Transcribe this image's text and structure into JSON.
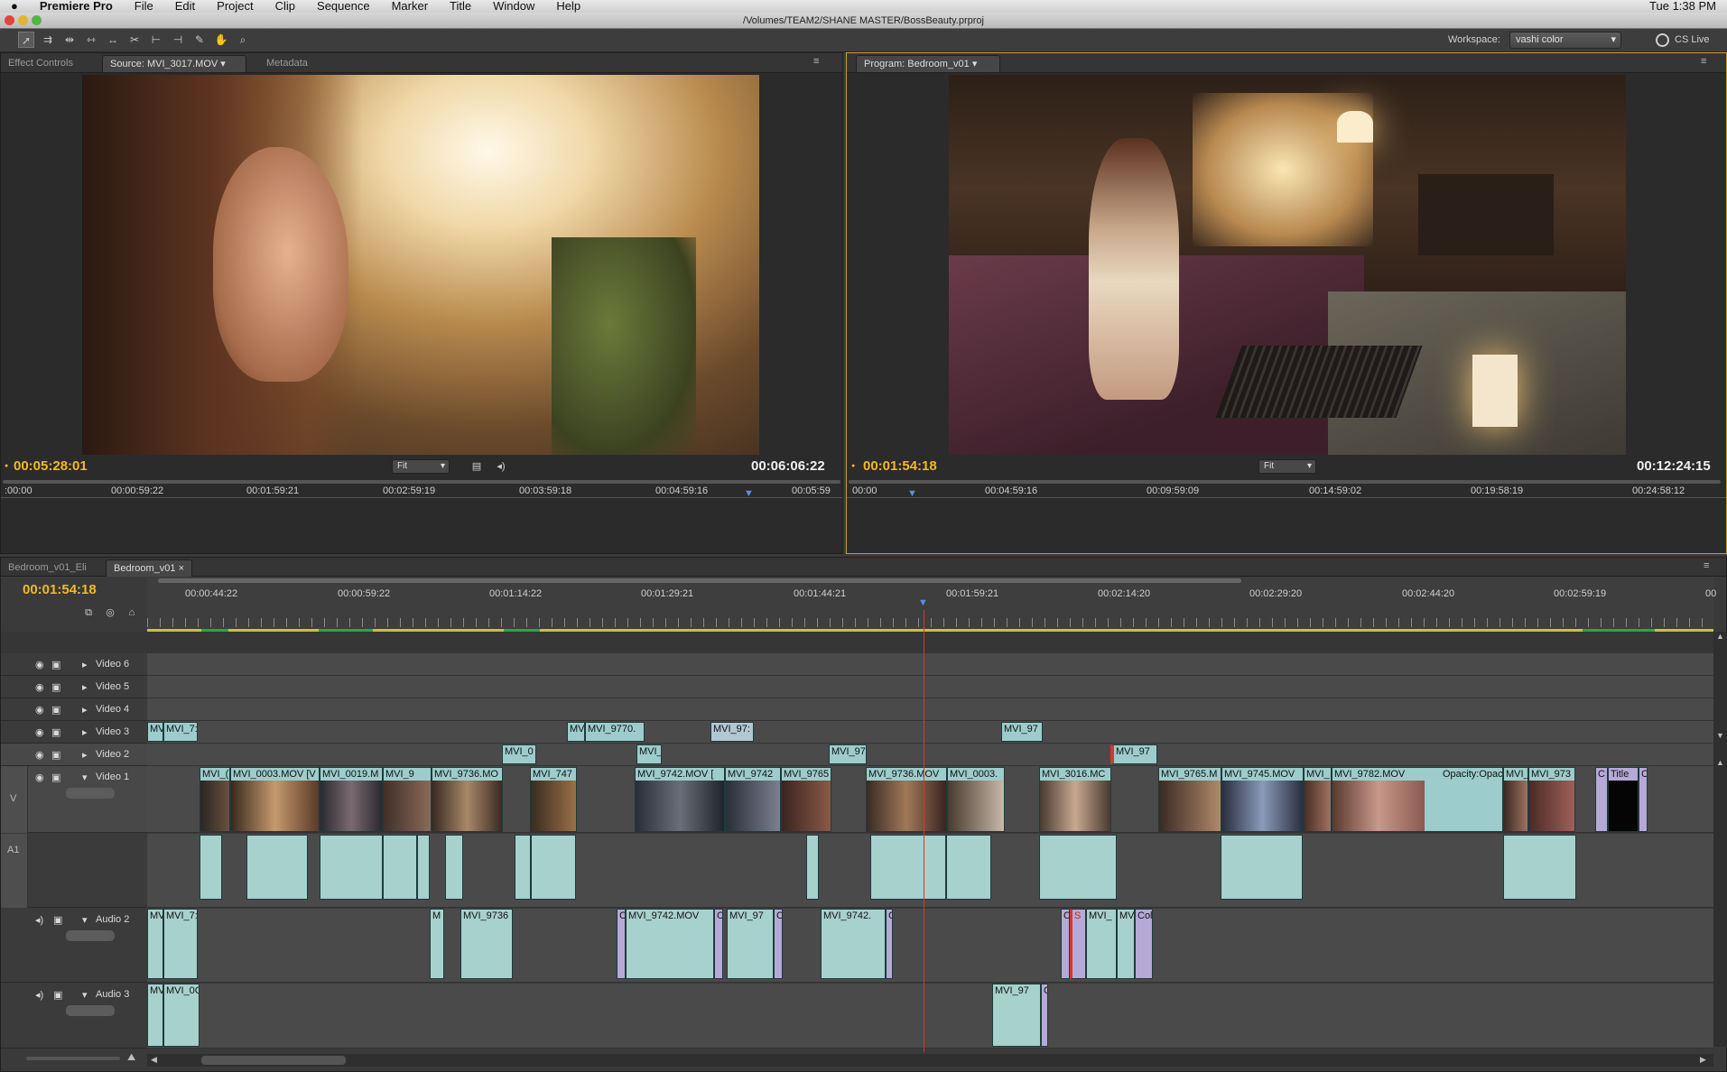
{
  "menubar": {
    "apple": "",
    "app": "Premiere Pro",
    "items": [
      "File",
      "Edit",
      "Project",
      "Clip",
      "Sequence",
      "Marker",
      "Title",
      "Window",
      "Help"
    ],
    "clock": "Tue 1:38 PM"
  },
  "titlebar": {
    "path": "/Volumes/TEAM2/SHANE MASTER/BossBeauty.prproj"
  },
  "toolbar": {
    "workspace_label": "Workspace:",
    "workspace_value": "vashi color",
    "cslive": "CS Live"
  },
  "source_panel": {
    "tabs": [
      "Effect Controls",
      "Source: MVI_3017.MOV",
      "Metadata"
    ],
    "current_tc": "00:05:28:01",
    "duration_tc": "00:06:06:22",
    "fit": "Fit",
    "ruler": ":00:00",
    "ruler_ticks": [
      "00:00:59:22",
      "00:01:59:21",
      "00:02:59:19",
      "00:03:59:18",
      "00:04:59:16",
      "00:05:59"
    ]
  },
  "program_panel": {
    "tab": "Program: Bedroom_v01",
    "current_tc": "00:01:54:18",
    "duration_tc": "00:12:24:15",
    "fit": "Fit",
    "ruler": "00:00",
    "ruler_ticks": [
      "00:04:59:16",
      "00:09:59:09",
      "00:14:59:02",
      "00:19:58:19",
      "00:24:58:12"
    ]
  },
  "timeline": {
    "tabs": [
      "Bedroom_v01_Eli",
      "Bedroom_v01"
    ],
    "current_tc": "00:01:54:18",
    "ruler_ticks": [
      "00:00:44:22",
      "00:00:59:22",
      "00:01:14:22",
      "00:01:29:21",
      "00:01:44:21",
      "00:01:59:21",
      "00:02:14:20",
      "00:02:29:20",
      "00:02:44:20",
      "00:02:59:19",
      "00"
    ],
    "tracks": {
      "v6": "Video 6",
      "v5": "Video 5",
      "v4": "Video 4",
      "v3": "Video 3",
      "v2": "Video 2",
      "v1": "Video 1",
      "v_side": "V",
      "a1_side": "A1",
      "a2": "Audio 2",
      "a3": "Audio 3"
    },
    "clips": {
      "v3": [
        "MV",
        "MVI_7:",
        "MV",
        "MVI_9770.",
        "MVI_97:",
        "MVI_97"
      ],
      "v2": [
        "MVI_0",
        "MVI_",
        "MVI_97",
        "MVI_97"
      ],
      "v1": [
        "MVI_(",
        "MVI_0003.MOV [V",
        "MVI_0019.M",
        "MVI_9",
        "MVI_9736.MO",
        "MVI_747",
        "MVI_9742.MOV [",
        "MVI_9742",
        "MVI_9765",
        "MVI_9736.MOV",
        "MVI_0003.",
        "MVI_3016.MC",
        "MVI_9765.M",
        "MVI_9745.MOV",
        "MVI_",
        "MVI_9782.MOV",
        "Opacity:Opacity",
        "MVI_",
        "MVI_973",
        "C",
        "Title",
        "C"
      ],
      "a2": [
        "MV",
        "MVI_7:",
        "M",
        "MVI_9736",
        "C",
        "MVI_9742.MOV",
        "C",
        "MVI_97",
        "C",
        "MVI_9742.",
        "C",
        "C",
        "S",
        "MVI_",
        "MV",
        "Col"
      ],
      "a3": [
        "MV",
        "MVI_0C",
        "MVI_97",
        "C"
      ]
    }
  },
  "colors": {
    "timecode": "#f2b928",
    "playhead": "#d43a2a",
    "clip_video": "#9ccccb",
    "clip_purple": "#b6a9d8"
  }
}
